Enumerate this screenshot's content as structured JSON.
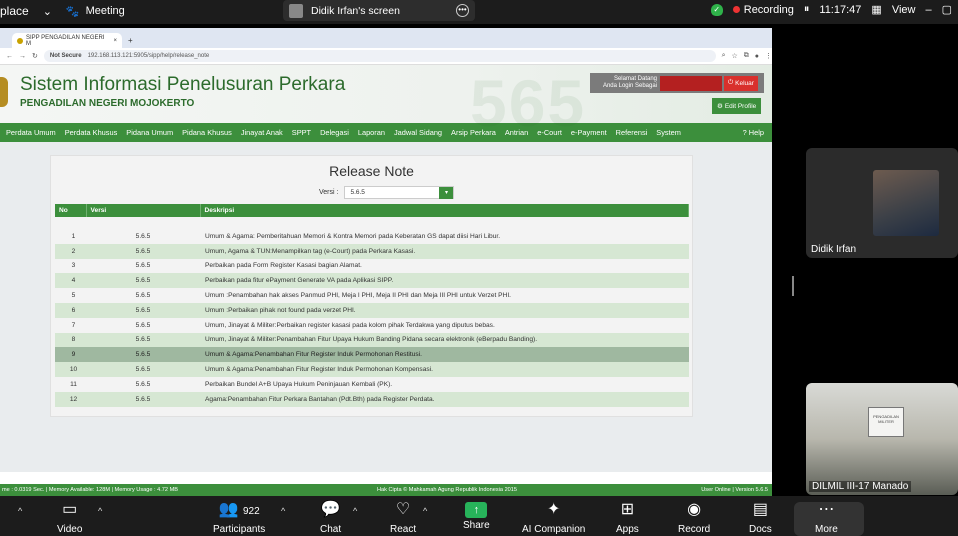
{
  "zoom_top": {
    "app_label": "place",
    "meeting_label": "Meeting",
    "share_label": "Didik Irfan's screen",
    "recording_label": "Recording",
    "time": "11:17:47",
    "view_label": "View"
  },
  "browser": {
    "tab_title": "SIPP PENGADILAN NEGERI M",
    "not_secure": "Not Secure",
    "url": "192.168.113.121:5905/sipp/help/release_note"
  },
  "site": {
    "title": "Sistem Informasi Penelusuran Perkara",
    "subtitle": "PENGADILAN NEGERI MOJOKERTO",
    "watermark": "565",
    "welcome_line1": "Selamat Datang",
    "welcome_line2": "Anda Login Sebagai",
    "logout_label": "Keluar",
    "edit_profile_label": "Edit Profile",
    "help_label": "Help"
  },
  "menu": [
    "Perdata Umum",
    "Perdata Khusus",
    "Pidana Umum",
    "Pidana Khusus",
    "Jinayat Anak",
    "SPPT",
    "Delegasi",
    "Laporan",
    "Jadwal Sidang",
    "Arsip Perkara",
    "Antrian",
    "e-Court",
    "e-Payment",
    "Referensi",
    "System"
  ],
  "release": {
    "title": "Release Note",
    "versi_label": "Versi :",
    "versi_value": "5.6.5",
    "columns": [
      "No",
      "Versi",
      "Deskripsi"
    ],
    "rows": [
      {
        "no": "1",
        "ver": "5.6.5",
        "desc": "Umum & Agama: Pemberitahuan Memori & Kontra Memori pada Keberatan GS dapat diisi Hari Libur."
      },
      {
        "no": "2",
        "ver": "5.6.5",
        "desc": "Umum, Agama & TUN:Menampilkan tag (e-Court) pada Perkara Kasasi."
      },
      {
        "no": "3",
        "ver": "5.6.5",
        "desc": "Perbaikan pada Form Register Kasasi bagian Alamat."
      },
      {
        "no": "4",
        "ver": "5.6.5",
        "desc": "Perbaikan pada fitur ePayment Generate VA pada Aplikasi SIPP."
      },
      {
        "no": "5",
        "ver": "5.6.5",
        "desc": "Umum :Penambahan hak akses Panmud PHI, Meja I PHI, Meja II PHI dan Meja III PHI untuk Verzet PHI."
      },
      {
        "no": "6",
        "ver": "5.6.5",
        "desc": "Umum :Perbaikan pihak not found pada verzet PHI."
      },
      {
        "no": "7",
        "ver": "5.6.5",
        "desc": "Umum, Jinayat & Militer:Perbaikan register kasasi pada kolom pihak Terdakwa yang diputus bebas."
      },
      {
        "no": "8",
        "ver": "5.6.5",
        "desc": "Umum, Jinayat & Militer:Penambahan Fitur Upaya Hukum Banding Pidana secara elektronik (eBerpadu Banding)."
      },
      {
        "no": "9",
        "ver": "5.6.5",
        "desc": "Umum & Agama:Penambahan Fitur Register Induk Permohonan Restitusi."
      },
      {
        "no": "10",
        "ver": "5.6.5",
        "desc": "Umum & Agama:Penambahan Fitur Register Induk Permohonan Kompensasi."
      },
      {
        "no": "11",
        "ver": "5.6.5",
        "desc": "Perbaikan Bundel A+B Upaya Hukum Peninjauan Kembali (PK)."
      },
      {
        "no": "12",
        "ver": "5.6.5",
        "desc": "Agama:Penambahan Fitur Perkara Bantahan (Pdt.Bth) pada Register Perdata."
      }
    ]
  },
  "statusbar": {
    "left": "me : 0.0319 Sec. | Memory Available: 128M | Memory Usage : 4.72 MB",
    "center": "Hak Cipta © Mahkamah Agung Republik Indonesia 2015",
    "right": "User Online | Version 5.6.5"
  },
  "videos": {
    "participant1": "Didik Irfan",
    "participant2": "DILMIL III-17 Manado",
    "room_board": "PENGADILAN MILITER"
  },
  "toolbar": {
    "video": "Video",
    "participants": "Participants",
    "participants_count": "922",
    "chat": "Chat",
    "react": "React",
    "share": "Share",
    "ai": "AI Companion",
    "apps": "Apps",
    "record": "Record",
    "docs": "Docs",
    "more": "More"
  },
  "colors": {
    "green": "#3c8f3c",
    "light_green_row": "#d6e7d3",
    "highlight_row": "#9fb8a0"
  }
}
